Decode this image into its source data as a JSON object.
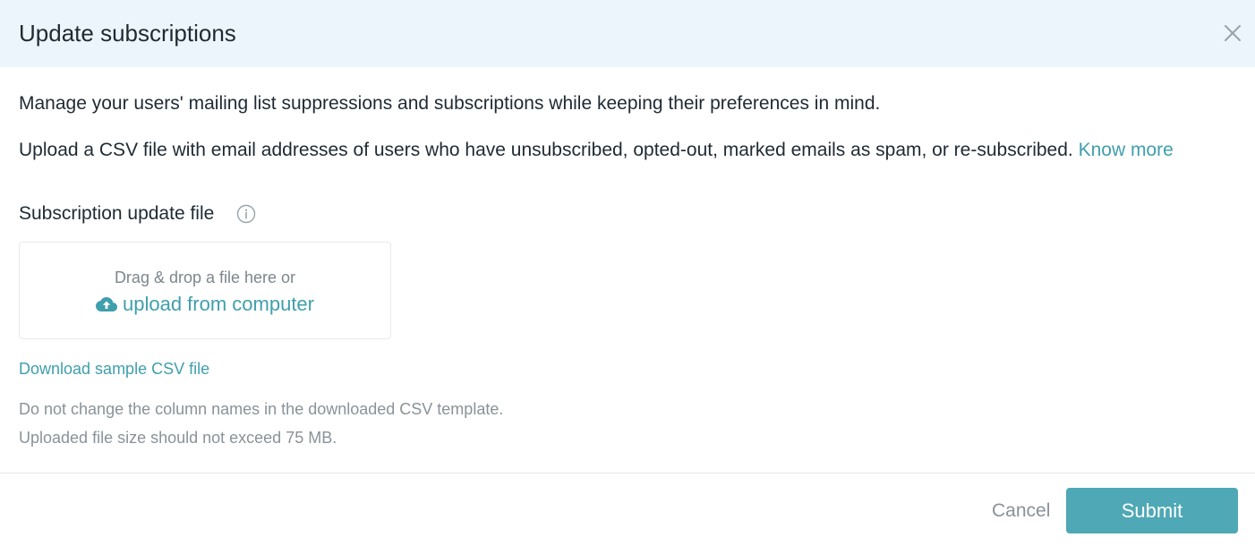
{
  "modal": {
    "title": "Update subscriptions",
    "close_icon": "close-icon"
  },
  "body": {
    "intro": "Manage your users' mailing list suppressions and subscriptions while keeping their preferences in mind.",
    "upload_text": "Upload a CSV file with email addresses of users who have unsubscribed, opted-out, marked emails as spam, or re-subscribed.",
    "know_more_link": "Know more"
  },
  "field": {
    "label": "Subscription update file",
    "info_icon": "info-icon"
  },
  "dropzone": {
    "hint": "Drag & drop a file here or",
    "upload_label": "upload from computer",
    "upload_icon": "cloud-upload-icon"
  },
  "sample_link": "Download sample CSV file",
  "notes": [
    "Do not change the column names in the downloaded CSV template.",
    "Uploaded file size should not exceed 75 MB."
  ],
  "footer": {
    "cancel_label": "Cancel",
    "submit_label": "Submit"
  },
  "colors": {
    "header_bg": "#edf5fc",
    "accent": "#3f9fac",
    "submit_bg": "#4ea8b6"
  }
}
